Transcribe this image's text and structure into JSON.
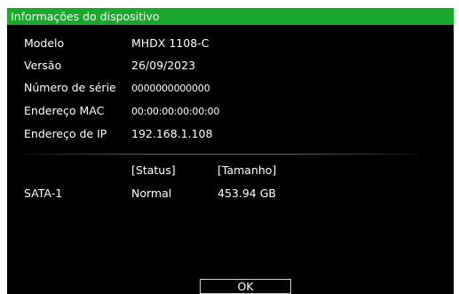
{
  "dialog": {
    "title": "Informações do dispositivo"
  },
  "device_info": [
    {
      "label": "Modelo",
      "value": "MHDX 1108-C"
    },
    {
      "label": "Versão",
      "value": "26/09/2023"
    },
    {
      "label": "Número de série",
      "value": "0000000000000"
    },
    {
      "label": "Endereço MAC",
      "value": "00:00:00:00:00:00"
    },
    {
      "label": "Endereço de IP",
      "value": "192.168.1.108"
    }
  ],
  "disks": {
    "headers": {
      "status": "[Status]",
      "size": "[Tamanho]"
    },
    "rows": [
      {
        "name": "SATA-1",
        "status": "Normal",
        "size": "453.94 GB"
      }
    ]
  },
  "buttons": {
    "ok_label": "OK"
  },
  "colors": {
    "title_bar": "#17a82c",
    "background": "#000000",
    "text": "#ffffff"
  }
}
